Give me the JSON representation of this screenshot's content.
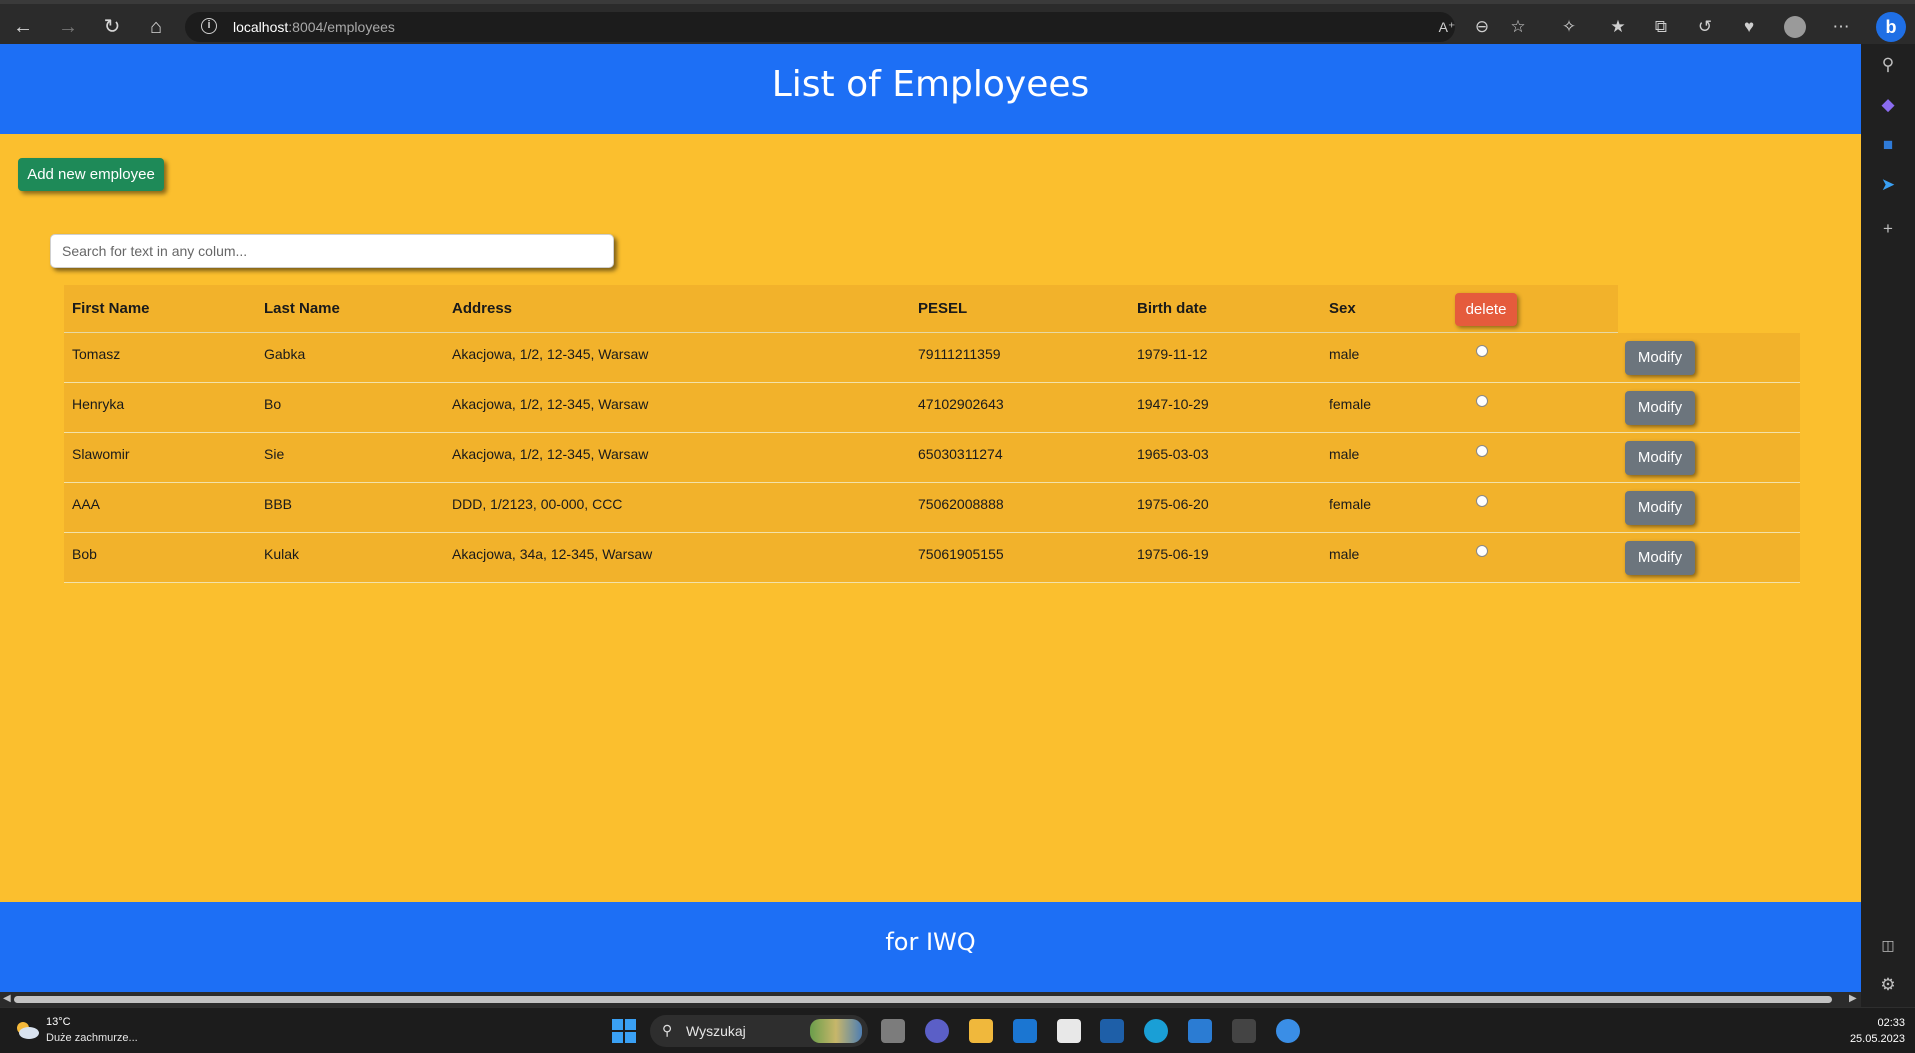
{
  "browser": {
    "url_host": "localhost",
    "url_rest": ":8004/employees"
  },
  "page": {
    "title": "List of Employees",
    "add_button": "Add new employee",
    "search_placeholder": "Search for text in any colum...",
    "delete_button": "delete",
    "modify_button": "Modify",
    "footer": "for IWQ"
  },
  "table": {
    "columns": [
      "First Name",
      "Last Name",
      "Address",
      "PESEL",
      "Birth date",
      "Sex"
    ],
    "rows": [
      [
        "Tomasz",
        "Gabka",
        "Akacjowa, 1/2, 12-345, Warsaw",
        "79111211359",
        "1979-11-12",
        "male"
      ],
      [
        "Henryka",
        "Bo",
        "Akacjowa, 1/2, 12-345, Warsaw",
        "47102902643",
        "1947-10-29",
        "female"
      ],
      [
        "Slawomir",
        "Sie",
        "Akacjowa, 1/2, 12-345, Warsaw",
        "65030311274",
        "1965-03-03",
        "male"
      ],
      [
        "AAA",
        "BBB",
        "DDD, 1/2123, 00-000, CCC",
        "75062008888",
        "1975-06-20",
        "female"
      ],
      [
        "Bob",
        "Kulak",
        "Akacjowa, 34a, 12-345, Warsaw",
        "75061905155",
        "1975-06-19",
        "male"
      ]
    ]
  },
  "taskbar": {
    "weather_temp": "13°C",
    "weather_desc": "Duże zachmurze...",
    "search_label": "Wyszukaj",
    "time": "02:33",
    "date": "25.05.2023"
  },
  "colors": {
    "header_blue": "#1d6ff5",
    "page_yellow": "#fbbf2e",
    "add_green": "#1e8a58",
    "delete_red": "#e55b3c",
    "modify_gray": "#6c757d"
  }
}
